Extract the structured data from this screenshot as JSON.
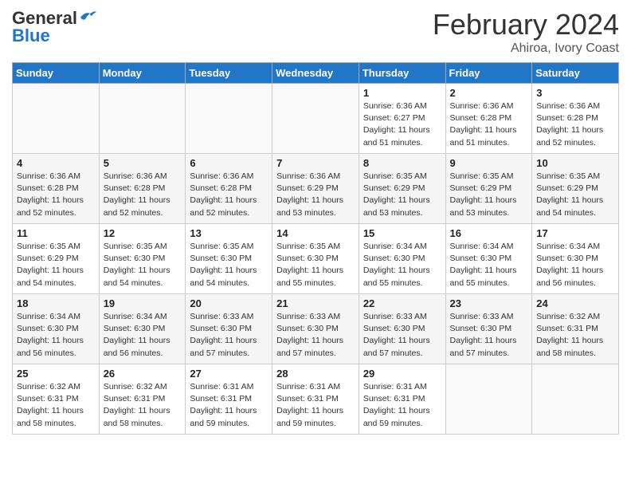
{
  "header": {
    "logo_general": "General",
    "logo_blue": "Blue",
    "month_title": "February 2024",
    "location": "Ahiroa, Ivory Coast"
  },
  "weekdays": [
    "Sunday",
    "Monday",
    "Tuesday",
    "Wednesday",
    "Thursday",
    "Friday",
    "Saturday"
  ],
  "weeks": [
    [
      {
        "day": "",
        "info": ""
      },
      {
        "day": "",
        "info": ""
      },
      {
        "day": "",
        "info": ""
      },
      {
        "day": "",
        "info": ""
      },
      {
        "day": "1",
        "info": "Sunrise: 6:36 AM\nSunset: 6:27 PM\nDaylight: 11 hours\nand 51 minutes."
      },
      {
        "day": "2",
        "info": "Sunrise: 6:36 AM\nSunset: 6:28 PM\nDaylight: 11 hours\nand 51 minutes."
      },
      {
        "day": "3",
        "info": "Sunrise: 6:36 AM\nSunset: 6:28 PM\nDaylight: 11 hours\nand 52 minutes."
      }
    ],
    [
      {
        "day": "4",
        "info": "Sunrise: 6:36 AM\nSunset: 6:28 PM\nDaylight: 11 hours\nand 52 minutes."
      },
      {
        "day": "5",
        "info": "Sunrise: 6:36 AM\nSunset: 6:28 PM\nDaylight: 11 hours\nand 52 minutes."
      },
      {
        "day": "6",
        "info": "Sunrise: 6:36 AM\nSunset: 6:28 PM\nDaylight: 11 hours\nand 52 minutes."
      },
      {
        "day": "7",
        "info": "Sunrise: 6:36 AM\nSunset: 6:29 PM\nDaylight: 11 hours\nand 53 minutes."
      },
      {
        "day": "8",
        "info": "Sunrise: 6:35 AM\nSunset: 6:29 PM\nDaylight: 11 hours\nand 53 minutes."
      },
      {
        "day": "9",
        "info": "Sunrise: 6:35 AM\nSunset: 6:29 PM\nDaylight: 11 hours\nand 53 minutes."
      },
      {
        "day": "10",
        "info": "Sunrise: 6:35 AM\nSunset: 6:29 PM\nDaylight: 11 hours\nand 54 minutes."
      }
    ],
    [
      {
        "day": "11",
        "info": "Sunrise: 6:35 AM\nSunset: 6:29 PM\nDaylight: 11 hours\nand 54 minutes."
      },
      {
        "day": "12",
        "info": "Sunrise: 6:35 AM\nSunset: 6:30 PM\nDaylight: 11 hours\nand 54 minutes."
      },
      {
        "day": "13",
        "info": "Sunrise: 6:35 AM\nSunset: 6:30 PM\nDaylight: 11 hours\nand 54 minutes."
      },
      {
        "day": "14",
        "info": "Sunrise: 6:35 AM\nSunset: 6:30 PM\nDaylight: 11 hours\nand 55 minutes."
      },
      {
        "day": "15",
        "info": "Sunrise: 6:34 AM\nSunset: 6:30 PM\nDaylight: 11 hours\nand 55 minutes."
      },
      {
        "day": "16",
        "info": "Sunrise: 6:34 AM\nSunset: 6:30 PM\nDaylight: 11 hours\nand 55 minutes."
      },
      {
        "day": "17",
        "info": "Sunrise: 6:34 AM\nSunset: 6:30 PM\nDaylight: 11 hours\nand 56 minutes."
      }
    ],
    [
      {
        "day": "18",
        "info": "Sunrise: 6:34 AM\nSunset: 6:30 PM\nDaylight: 11 hours\nand 56 minutes."
      },
      {
        "day": "19",
        "info": "Sunrise: 6:34 AM\nSunset: 6:30 PM\nDaylight: 11 hours\nand 56 minutes."
      },
      {
        "day": "20",
        "info": "Sunrise: 6:33 AM\nSunset: 6:30 PM\nDaylight: 11 hours\nand 57 minutes."
      },
      {
        "day": "21",
        "info": "Sunrise: 6:33 AM\nSunset: 6:30 PM\nDaylight: 11 hours\nand 57 minutes."
      },
      {
        "day": "22",
        "info": "Sunrise: 6:33 AM\nSunset: 6:30 PM\nDaylight: 11 hours\nand 57 minutes."
      },
      {
        "day": "23",
        "info": "Sunrise: 6:33 AM\nSunset: 6:30 PM\nDaylight: 11 hours\nand 57 minutes."
      },
      {
        "day": "24",
        "info": "Sunrise: 6:32 AM\nSunset: 6:31 PM\nDaylight: 11 hours\nand 58 minutes."
      }
    ],
    [
      {
        "day": "25",
        "info": "Sunrise: 6:32 AM\nSunset: 6:31 PM\nDaylight: 11 hours\nand 58 minutes."
      },
      {
        "day": "26",
        "info": "Sunrise: 6:32 AM\nSunset: 6:31 PM\nDaylight: 11 hours\nand 58 minutes."
      },
      {
        "day": "27",
        "info": "Sunrise: 6:31 AM\nSunset: 6:31 PM\nDaylight: 11 hours\nand 59 minutes."
      },
      {
        "day": "28",
        "info": "Sunrise: 6:31 AM\nSunset: 6:31 PM\nDaylight: 11 hours\nand 59 minutes."
      },
      {
        "day": "29",
        "info": "Sunrise: 6:31 AM\nSunset: 6:31 PM\nDaylight: 11 hours\nand 59 minutes."
      },
      {
        "day": "",
        "info": ""
      },
      {
        "day": "",
        "info": ""
      }
    ]
  ]
}
